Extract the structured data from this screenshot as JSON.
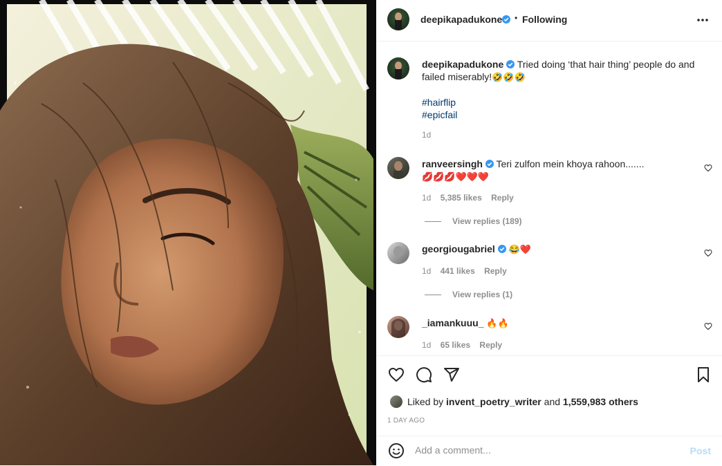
{
  "header": {
    "username": "deepikapadukone",
    "separator": "•",
    "follow_state": "Following",
    "more_icon": "more-horizontal-icon"
  },
  "caption": {
    "username": "deepikapadukone",
    "text": "Tried doing ‘that hair thing’ people do and failed miserably!",
    "emojis": "🤣🤣🤣",
    "hashtags": [
      "#hairflip",
      "#epicfail"
    ],
    "age": "1d"
  },
  "comments": [
    {
      "username": "ranveersingh",
      "verified": true,
      "text": "Teri zulfon mein khoya rahoon.......",
      "emojis": "💋💋💋❤️❤️❤️",
      "age": "1d",
      "likes": "5,385 likes",
      "reply": "Reply",
      "view_replies": "View replies (189)"
    },
    {
      "username": "georgiougabriel",
      "verified": true,
      "text": "",
      "emojis": "😂❤️",
      "age": "1d",
      "likes": "441 likes",
      "reply": "Reply",
      "view_replies": "View replies (1)"
    },
    {
      "username": "_iamankuuu_",
      "verified": false,
      "text": "",
      "emojis": "🔥🔥",
      "age": "1d",
      "likes": "65 likes",
      "reply": "Reply"
    }
  ],
  "actions": {
    "like_icon": "heart-icon",
    "comment_icon": "comment-icon",
    "share_icon": "share-icon",
    "save_icon": "bookmark-icon"
  },
  "likes": {
    "prefix": "Liked by",
    "user": "invent_poetry_writer",
    "conj": "and",
    "others": "1,559,983 others"
  },
  "date": "1 DAY AGO",
  "add_comment": {
    "placeholder": "Add a comment...",
    "post_label": "Post",
    "emoji_icon": "smiley-icon"
  },
  "colors": {
    "verified_blue": "#3897f0",
    "link_blue": "#00376b",
    "post_disabled": "#b2dffc",
    "muted": "#8e8e8e"
  }
}
